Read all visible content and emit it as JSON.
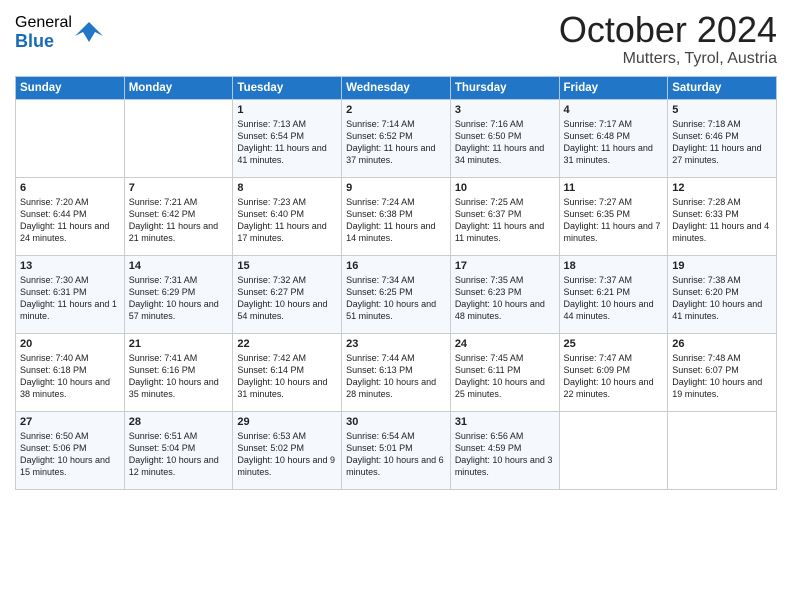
{
  "header": {
    "logo_general": "General",
    "logo_blue": "Blue",
    "month_title": "October 2024",
    "location": "Mutters, Tyrol, Austria"
  },
  "days_of_week": [
    "Sunday",
    "Monday",
    "Tuesday",
    "Wednesday",
    "Thursday",
    "Friday",
    "Saturday"
  ],
  "weeks": [
    [
      {
        "day": "",
        "info": ""
      },
      {
        "day": "",
        "info": ""
      },
      {
        "day": "1",
        "info": "Sunrise: 7:13 AM\nSunset: 6:54 PM\nDaylight: 11 hours and 41 minutes."
      },
      {
        "day": "2",
        "info": "Sunrise: 7:14 AM\nSunset: 6:52 PM\nDaylight: 11 hours and 37 minutes."
      },
      {
        "day": "3",
        "info": "Sunrise: 7:16 AM\nSunset: 6:50 PM\nDaylight: 11 hours and 34 minutes."
      },
      {
        "day": "4",
        "info": "Sunrise: 7:17 AM\nSunset: 6:48 PM\nDaylight: 11 hours and 31 minutes."
      },
      {
        "day": "5",
        "info": "Sunrise: 7:18 AM\nSunset: 6:46 PM\nDaylight: 11 hours and 27 minutes."
      }
    ],
    [
      {
        "day": "6",
        "info": "Sunrise: 7:20 AM\nSunset: 6:44 PM\nDaylight: 11 hours and 24 minutes."
      },
      {
        "day": "7",
        "info": "Sunrise: 7:21 AM\nSunset: 6:42 PM\nDaylight: 11 hours and 21 minutes."
      },
      {
        "day": "8",
        "info": "Sunrise: 7:23 AM\nSunset: 6:40 PM\nDaylight: 11 hours and 17 minutes."
      },
      {
        "day": "9",
        "info": "Sunrise: 7:24 AM\nSunset: 6:38 PM\nDaylight: 11 hours and 14 minutes."
      },
      {
        "day": "10",
        "info": "Sunrise: 7:25 AM\nSunset: 6:37 PM\nDaylight: 11 hours and 11 minutes."
      },
      {
        "day": "11",
        "info": "Sunrise: 7:27 AM\nSunset: 6:35 PM\nDaylight: 11 hours and 7 minutes."
      },
      {
        "day": "12",
        "info": "Sunrise: 7:28 AM\nSunset: 6:33 PM\nDaylight: 11 hours and 4 minutes."
      }
    ],
    [
      {
        "day": "13",
        "info": "Sunrise: 7:30 AM\nSunset: 6:31 PM\nDaylight: 11 hours and 1 minute."
      },
      {
        "day": "14",
        "info": "Sunrise: 7:31 AM\nSunset: 6:29 PM\nDaylight: 10 hours and 57 minutes."
      },
      {
        "day": "15",
        "info": "Sunrise: 7:32 AM\nSunset: 6:27 PM\nDaylight: 10 hours and 54 minutes."
      },
      {
        "day": "16",
        "info": "Sunrise: 7:34 AM\nSunset: 6:25 PM\nDaylight: 10 hours and 51 minutes."
      },
      {
        "day": "17",
        "info": "Sunrise: 7:35 AM\nSunset: 6:23 PM\nDaylight: 10 hours and 48 minutes."
      },
      {
        "day": "18",
        "info": "Sunrise: 7:37 AM\nSunset: 6:21 PM\nDaylight: 10 hours and 44 minutes."
      },
      {
        "day": "19",
        "info": "Sunrise: 7:38 AM\nSunset: 6:20 PM\nDaylight: 10 hours and 41 minutes."
      }
    ],
    [
      {
        "day": "20",
        "info": "Sunrise: 7:40 AM\nSunset: 6:18 PM\nDaylight: 10 hours and 38 minutes."
      },
      {
        "day": "21",
        "info": "Sunrise: 7:41 AM\nSunset: 6:16 PM\nDaylight: 10 hours and 35 minutes."
      },
      {
        "day": "22",
        "info": "Sunrise: 7:42 AM\nSunset: 6:14 PM\nDaylight: 10 hours and 31 minutes."
      },
      {
        "day": "23",
        "info": "Sunrise: 7:44 AM\nSunset: 6:13 PM\nDaylight: 10 hours and 28 minutes."
      },
      {
        "day": "24",
        "info": "Sunrise: 7:45 AM\nSunset: 6:11 PM\nDaylight: 10 hours and 25 minutes."
      },
      {
        "day": "25",
        "info": "Sunrise: 7:47 AM\nSunset: 6:09 PM\nDaylight: 10 hours and 22 minutes."
      },
      {
        "day": "26",
        "info": "Sunrise: 7:48 AM\nSunset: 6:07 PM\nDaylight: 10 hours and 19 minutes."
      }
    ],
    [
      {
        "day": "27",
        "info": "Sunrise: 6:50 AM\nSunset: 5:06 PM\nDaylight: 10 hours and 15 minutes."
      },
      {
        "day": "28",
        "info": "Sunrise: 6:51 AM\nSunset: 5:04 PM\nDaylight: 10 hours and 12 minutes."
      },
      {
        "day": "29",
        "info": "Sunrise: 6:53 AM\nSunset: 5:02 PM\nDaylight: 10 hours and 9 minutes."
      },
      {
        "day": "30",
        "info": "Sunrise: 6:54 AM\nSunset: 5:01 PM\nDaylight: 10 hours and 6 minutes."
      },
      {
        "day": "31",
        "info": "Sunrise: 6:56 AM\nSunset: 4:59 PM\nDaylight: 10 hours and 3 minutes."
      },
      {
        "day": "",
        "info": ""
      },
      {
        "day": "",
        "info": ""
      }
    ]
  ]
}
